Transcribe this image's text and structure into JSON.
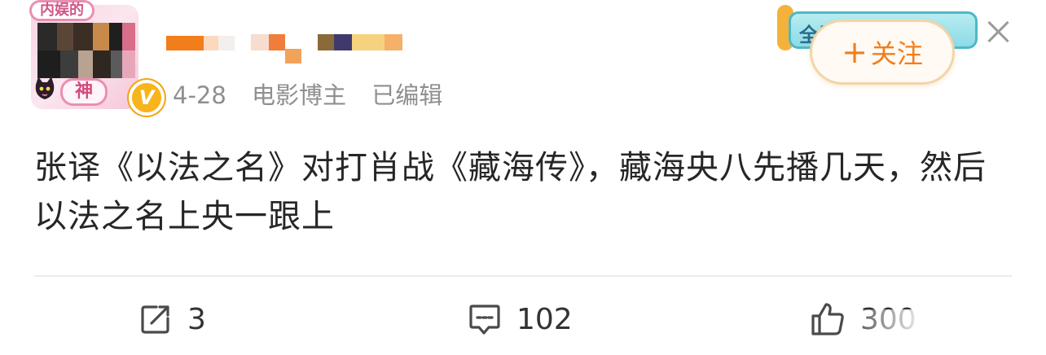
{
  "avatar": {
    "frame_top_text": "内娱的",
    "frame_bottom_text": "神",
    "verified_badge": "V"
  },
  "post": {
    "date": "4-28",
    "source": "电影博主",
    "edited": "已编辑",
    "text": "张译《以法之名》对打肖战《藏海传》，藏海央八先播几天，然后以法之名上央一跟上"
  },
  "event_banner": {
    "text": "全国巨"
  },
  "follow": {
    "plus": "+",
    "label": "关注"
  },
  "actions": {
    "reposts": "3",
    "comments": "102",
    "likes": "300"
  },
  "icons": {
    "close": "close-icon",
    "repost": "repost-icon",
    "comment": "comment-icon",
    "like": "thumbs-up-icon",
    "verified": "verified-v-icon"
  },
  "colors": {
    "accent_orange": "#f27d1b",
    "meta_gray": "#8f8f8f",
    "text_dark": "#262626",
    "badge_gold": "#f8b41b",
    "frame_pink": "#e98fb1"
  }
}
